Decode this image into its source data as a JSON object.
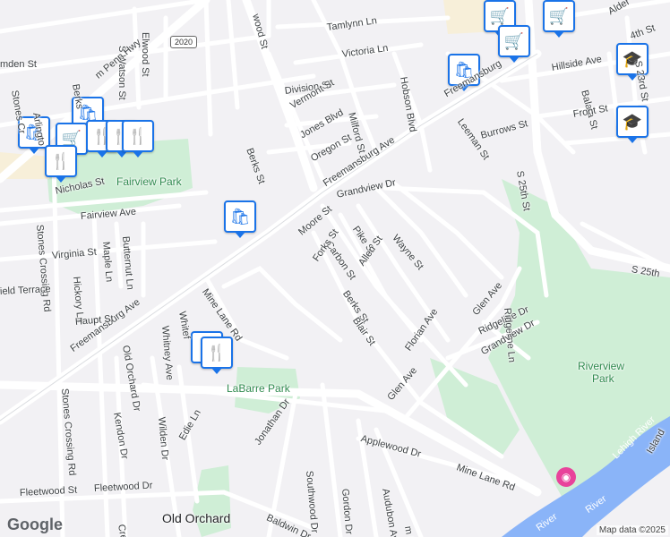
{
  "map": {
    "place_labels": {
      "old_orchard": "Old Orchard"
    },
    "parks": {
      "fairview": "Fairview Park",
      "labarre": "LaBarre Park",
      "riverview_1": "Riverview",
      "riverview_2": "Park"
    },
    "water": {
      "lehigh": "Lehigh River",
      "river_a": "River",
      "river_b": "River",
      "island": "Island"
    },
    "highway_shield": "2020",
    "streets": {
      "camden": "mden St",
      "elwood": "Elwood St",
      "s_watson": "S Watson St",
      "wood_st": "wood St",
      "tamlynn": "Tamlynn Ln",
      "victoria": "Victoria Ln",
      "wm_penn": "m Penn Hwy",
      "division": "Division St",
      "vermont": "Vermont St",
      "jones": "Jones Blvd",
      "milford": "Milford St",
      "oregon": "Oregon St",
      "hobson": "Hobson Blvd",
      "freemansburg_top": "Freemansburg",
      "freemansburg_mid": "Freemansburg Ave",
      "freemansburg_low": "Freemansburg Ave",
      "leeman": "Leeman St",
      "burrows": "Burrows St",
      "hillside": "Hillside Ave",
      "balata": "Balata St",
      "front": "Front St",
      "alder": "Alder",
      "fourth": "4th St",
      "s23rd": "S 23rd St",
      "s25th": "S 25th St",
      "s25th_e": "S 25th",
      "stones_top": "Stones Cr",
      "arlington": "Arlingto",
      "berks_top": "Berks",
      "berks_mid": "Berks St",
      "berks_low": "Berks St",
      "nicholas": "Nicholas St",
      "grandview": "Grandview Dr",
      "moore": "Moore St",
      "pike": "Pike St",
      "wayne": "Wayne St",
      "carbon": "Carbon St",
      "allen": "Allen St",
      "forks": "Forks St",
      "fairview_ave": "Fairview Ave",
      "virginia": "Virginia St",
      "maple": "Maple Ln",
      "butternut": "Butternut Ln",
      "hickory": "Hickory Ln",
      "stones_rd": "Stones Crossing Rd",
      "stones_rd_low": "Stones Crossing Rd",
      "fairfield": "ield Terrace",
      "haupt": "Haupt St",
      "mine_lane": "Mine Lane Rd",
      "mine_lane_low": "Mine Lane Rd",
      "whitef": "Whitef",
      "whitney": "Whitney Ave",
      "old_orchard_dr": "Old Orchard Dr",
      "kendon": "Kendon Dr",
      "wilden": "Wilden Dr",
      "edie": "Edie Ln",
      "jonathan": "Jonathan Dr",
      "blair": "Blair St",
      "florian": "Florian Ave",
      "glen_ave": "Glen Ave",
      "glen_ave2": "Glen Ave",
      "ridgeline": "Ridgeline Dr",
      "ridgeline_ln": "Ridgeline Ln",
      "grandview_dr2": "Grandview Dr",
      "applewood": "Applewood Dr",
      "southwood": "Southwood Dr",
      "gordon": "Gordon Dr",
      "audubon": "Audubon Ave",
      "fleetwood": "Fleetwood St",
      "fleetwood_dr": "Fleetwood Dr",
      "baldwin": "Baldwin Dr",
      "cre": "Cre",
      "m_rd": "m Rd"
    },
    "attribution": "Map data ©2025",
    "logo": "Google",
    "colors": {
      "background": "#f2f1f4",
      "road": "#ffffff",
      "major_road": "#ffffff",
      "park": "#cfeed6",
      "water": "#8ab4f8",
      "pin_blue": "#1a73e8"
    },
    "pins": [
      {
        "name": "shopping-bag-icon",
        "glyph": "🛍"
      },
      {
        "name": "shopping-bag-icon",
        "glyph": "🛍"
      },
      {
        "name": "shopping-bag-icon",
        "glyph": "🛍"
      },
      {
        "name": "shopping-cart-icon",
        "glyph": "🛒"
      },
      {
        "name": "shopping-cart-icon",
        "glyph": "🛒"
      },
      {
        "name": "restaurant-icon",
        "glyph": "🍴"
      },
      {
        "name": "restaurant-icon",
        "glyph": "🍴"
      },
      {
        "name": "restaurant-icon",
        "glyph": "🍴"
      },
      {
        "name": "restaurant-icon",
        "glyph": "🍴"
      },
      {
        "name": "school-icon",
        "glyph": "🎓"
      },
      {
        "name": "school-icon",
        "glyph": "🎓"
      },
      {
        "name": "shopping-bag-icon",
        "glyph": "🛍"
      },
      {
        "name": "shopping-cart-icon",
        "glyph": "🛒"
      },
      {
        "name": "shopping-cart-icon",
        "glyph": "🛒"
      },
      {
        "name": "restaurant-icon",
        "glyph": "🍴"
      },
      {
        "name": "restaurant-icon",
        "glyph": "🍴"
      }
    ]
  }
}
